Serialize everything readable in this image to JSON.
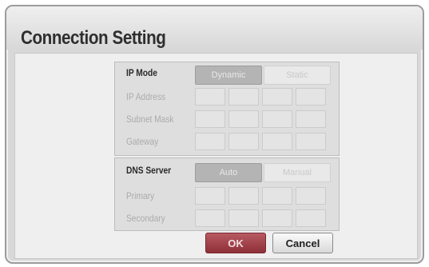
{
  "dialog": {
    "title": "Connection Setting"
  },
  "ip_section": {
    "mode_label": "IP Mode",
    "options": [
      "Dynamic",
      "Static"
    ],
    "selected": "Dynamic",
    "fields": [
      {
        "label": "IP Address"
      },
      {
        "label": "Subnet Mask"
      },
      {
        "label": "Gateway"
      }
    ]
  },
  "dns_section": {
    "mode_label": "DNS Server",
    "options": [
      "Auto",
      "Manual"
    ],
    "selected": "Auto",
    "fields": [
      {
        "label": "Primary"
      },
      {
        "label": "Secondary"
      }
    ]
  },
  "buttons": {
    "ok": "OK",
    "cancel": "Cancel"
  },
  "colors": {
    "ok_button": "#9b3a44",
    "panel": "#dedede",
    "background": "#efefef"
  }
}
